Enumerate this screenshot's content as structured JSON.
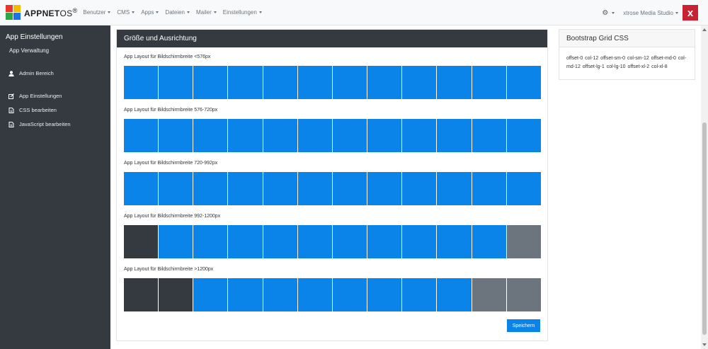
{
  "navbar": {
    "brand_bold": "APPNET",
    "brand_light": "OS",
    "brand_mark": "®",
    "menu": [
      {
        "label": "Benutzer"
      },
      {
        "label": "CMS"
      },
      {
        "label": "Apps"
      },
      {
        "label": "Dateien"
      },
      {
        "label": "Mailer"
      },
      {
        "label": "Einstellungen"
      }
    ],
    "user_label": "xtrose Media Studio",
    "badge_label": "x"
  },
  "sidebar": {
    "title": "App Einstellungen",
    "subtitle": "App Verwaltung",
    "items": [
      {
        "label": "Admin Bereich",
        "icon": "user-icon"
      },
      {
        "label": "App Einstellungen",
        "icon": "edit-icon"
      },
      {
        "label": "CSS bearbeiten",
        "icon": "file-icon"
      },
      {
        "label": "JavaScript bearbeiten",
        "icon": "file-icon"
      }
    ]
  },
  "main": {
    "header": "Größe und Ausrichtung",
    "rows": [
      {
        "label": "App Layout für Bildschirmbreite <576px",
        "offset": 0,
        "cols": 12,
        "trailing": 0
      },
      {
        "label": "App Layout für Bildschirmbreite 576-720px",
        "offset": 0,
        "cols": 12,
        "trailing": 0
      },
      {
        "label": "App Layout für Bildschirmbreite 720-992px",
        "offset": 0,
        "cols": 12,
        "trailing": 0
      },
      {
        "label": "App Layout für Bildschirmbreite 992-1200px",
        "offset": 1,
        "cols": 10,
        "trailing": 1
      },
      {
        "label": "App Layout für Bildschirmbreite >1200px",
        "offset": 2,
        "cols": 8,
        "trailing": 2
      }
    ],
    "save_label": "Speichern"
  },
  "side_card": {
    "title": "Bootstrap Grid CSS",
    "body": "offset-0 col-12 offset-sm-0 col-sm-12 offset-md-0 col-md-12 offset-lg-1 col-lg-10 offset-xl-2 col-xl-8"
  },
  "colors": {
    "offset": "#343a40",
    "col": "#0a84e8",
    "trailing": "#6c757d"
  }
}
